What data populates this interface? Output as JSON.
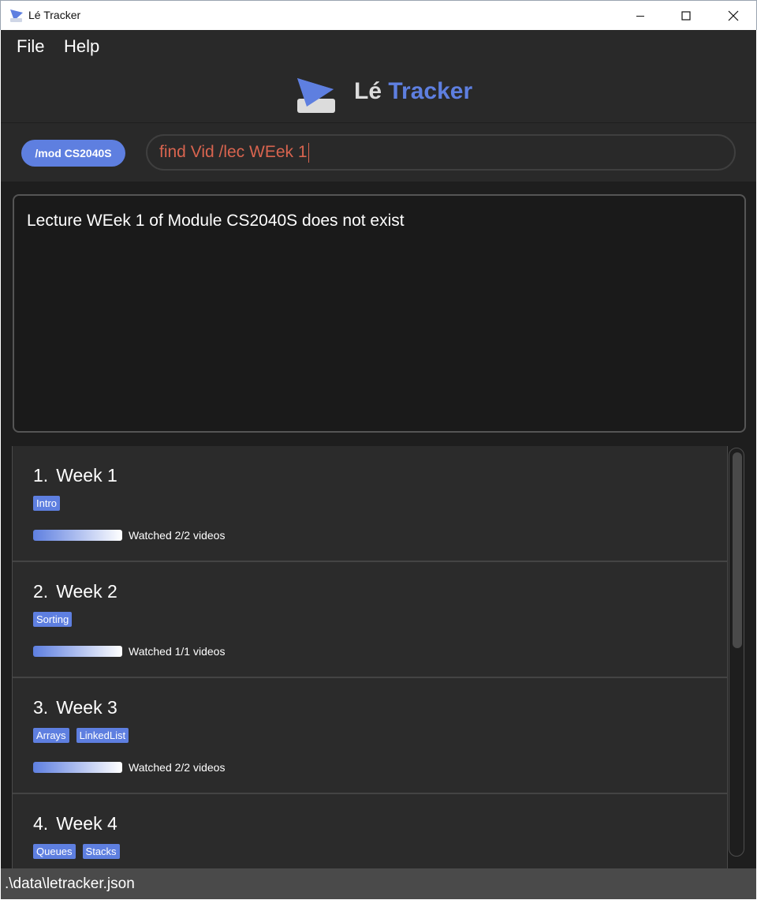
{
  "window": {
    "title": "Lé Tracker"
  },
  "menu": {
    "file": "File",
    "help": "Help"
  },
  "logo": {
    "le": "Lé",
    "tracker": "Tracker"
  },
  "command": {
    "module_pill": "/mod CS2040S",
    "input_value": "find Vid /lec WEek 1"
  },
  "result": {
    "message": "Lecture WEek 1 of Module CS2040S does not exist"
  },
  "lectures": [
    {
      "index": "1.",
      "name": "Week 1",
      "tags": [
        "Intro"
      ],
      "progress": 1.0,
      "watched_label": "Watched 2/2 videos"
    },
    {
      "index": "2.",
      "name": "Week 2",
      "tags": [
        "Sorting"
      ],
      "progress": 1.0,
      "watched_label": "Watched 1/1 videos"
    },
    {
      "index": "3.",
      "name": "Week 3",
      "tags": [
        "Arrays",
        "LinkedList"
      ],
      "progress": 1.0,
      "watched_label": "Watched 2/2 videos"
    },
    {
      "index": "4.",
      "name": "Week 4",
      "tags": [
        "Queues",
        "Stacks"
      ]
    }
  ],
  "status": {
    "path": ".\\data\\letracker.json"
  },
  "colors": {
    "accent": "#5e7fe0",
    "error_text": "#d8644f",
    "background": "#292929"
  }
}
